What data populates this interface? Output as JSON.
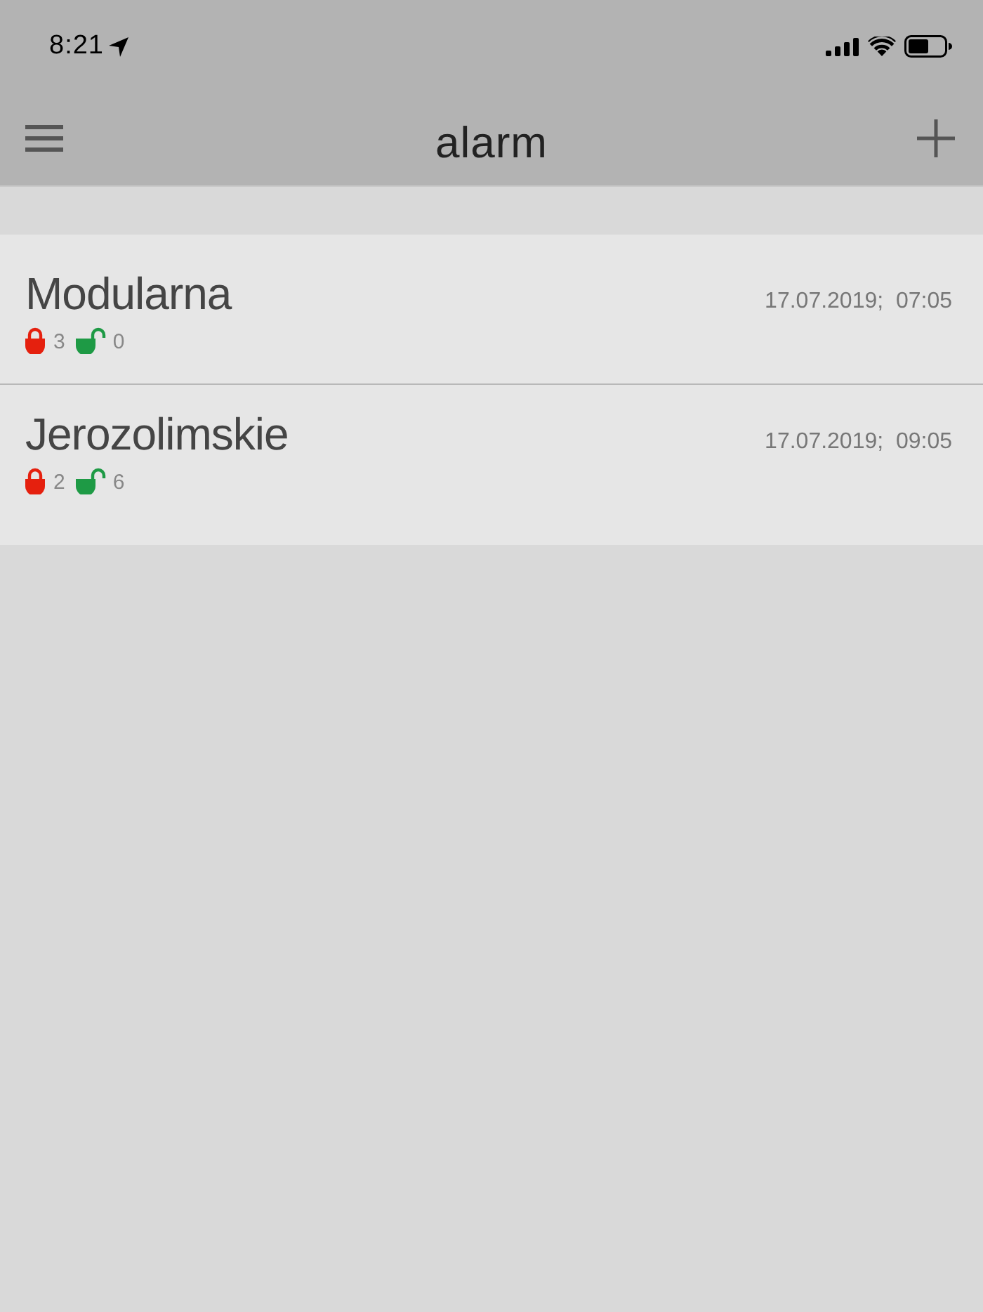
{
  "status_bar": {
    "time": "8:21"
  },
  "header": {
    "title": "alarm"
  },
  "sites": [
    {
      "name": "Modularna",
      "timestamp": "17.07.2019;  07:05",
      "locked_count": "3",
      "unlocked_count": "0"
    },
    {
      "name": "Jerozolimskie",
      "timestamp": "17.07.2019;  09:05",
      "locked_count": "2",
      "unlocked_count": "6"
    }
  ]
}
